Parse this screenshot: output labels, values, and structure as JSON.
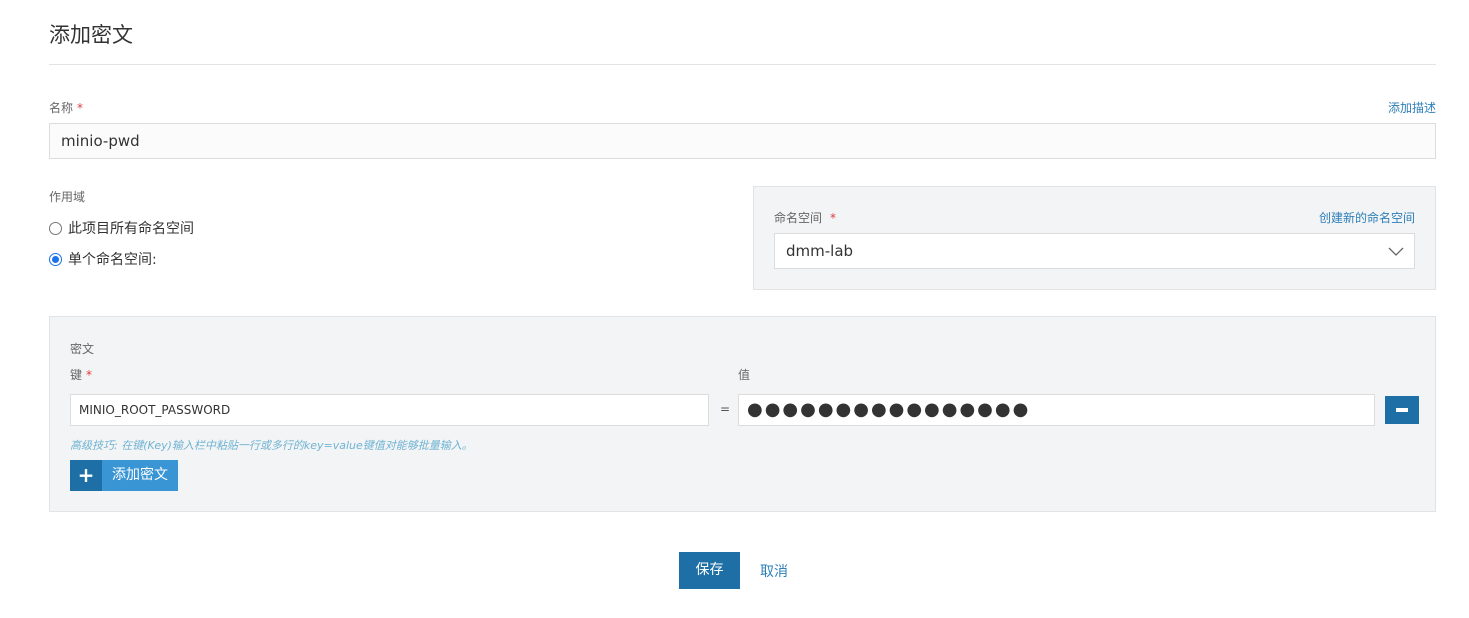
{
  "page": {
    "title": "添加密文"
  },
  "name": {
    "label": "名称",
    "required": "*",
    "value": "minio-pwd",
    "add_description": "添加描述"
  },
  "scope": {
    "label": "作用域",
    "options": [
      {
        "label": "此项目所有命名空间",
        "checked": false
      },
      {
        "label": "单个命名空间:",
        "checked": true
      }
    ]
  },
  "namespace": {
    "label": "命名空间",
    "required": "*",
    "create_link": "创建新的命名空间",
    "selected": "dmm-lab"
  },
  "secret": {
    "section_label": "密文",
    "key_label": "键",
    "key_required": "*",
    "value_label": "值",
    "key_value": "MINIO_ROOT_PASSWORD",
    "equals": "=",
    "masked_value": "●●●●●●●●●●●●●●●●",
    "hint": "高级技巧: 在键(Key)输入栏中粘贴一行或多行的key=value键值对能够批量输入。",
    "add_button": "添加密文"
  },
  "footer": {
    "save": "保存",
    "cancel": "取消"
  },
  "colors": {
    "primary": "#1d6fa5",
    "link": "#2d7fb8",
    "required": "#e03c3c",
    "panel_bg": "#f3f4f5"
  },
  "icons": {
    "chevron": "chevron-down-icon",
    "plus": "plus-icon",
    "remove": "minus-icon"
  }
}
